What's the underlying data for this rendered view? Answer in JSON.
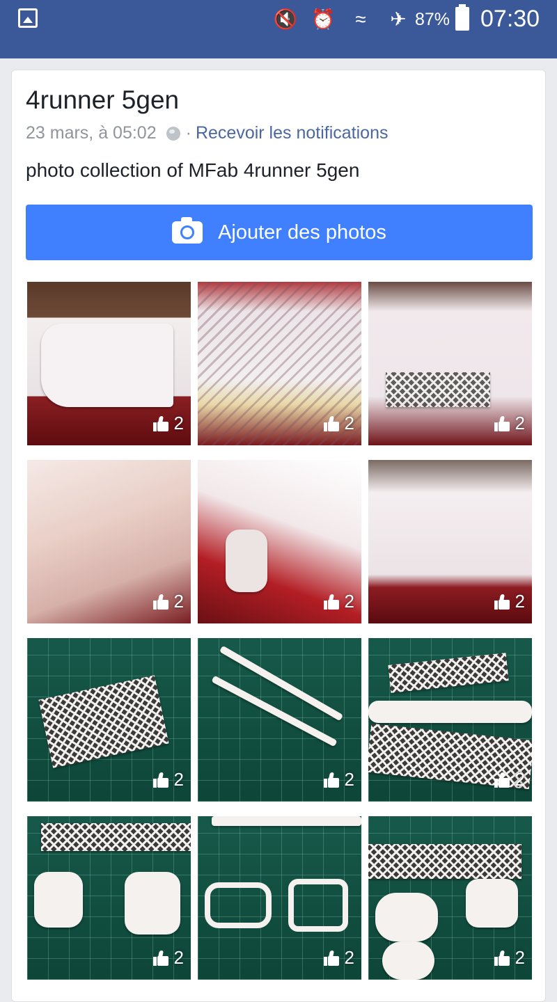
{
  "status_bar": {
    "icons": [
      "gallery-icon",
      "mute-icon",
      "alarm-icon",
      "wifi-icon",
      "airplane-icon",
      "battery-icon"
    ],
    "battery": "87%",
    "time": "07:30"
  },
  "post": {
    "title": "4runner 5gen",
    "date": "23 mars, à 05:02",
    "privacy_icon": "globe-icon",
    "separator": "·",
    "notifications_link": "Recevoir les notifications",
    "description": "photo collection of MFab 4runner 5gen"
  },
  "add_photos": {
    "label": "Ajouter des photos",
    "icon": "camera-icon",
    "color": "#4080ff"
  },
  "photos": [
    {
      "likes": "2"
    },
    {
      "likes": "2"
    },
    {
      "likes": "2"
    },
    {
      "likes": "2"
    },
    {
      "likes": "2"
    },
    {
      "likes": "2"
    },
    {
      "likes": "2"
    },
    {
      "likes": "2"
    },
    {
      "likes": "2"
    },
    {
      "likes": "2"
    },
    {
      "likes": "2"
    },
    {
      "likes": "2"
    }
  ],
  "colors": {
    "header": "#3b5998",
    "link": "#4b67a1"
  }
}
